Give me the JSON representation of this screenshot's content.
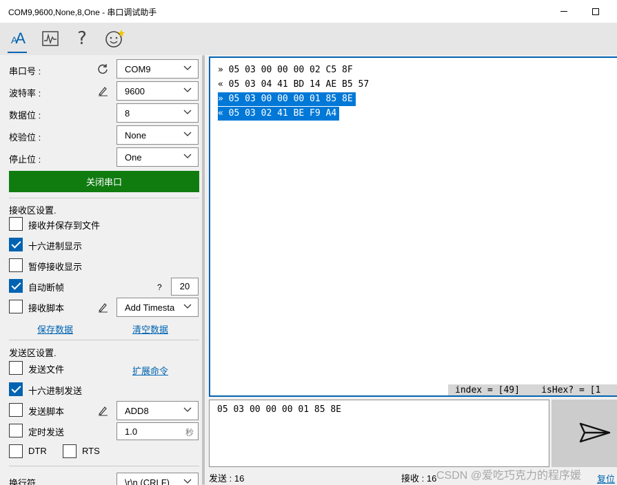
{
  "window": {
    "title": "COM9,9600,None,8,One - 串口调试助手"
  },
  "toolbar": {
    "font_glyph": "AA",
    "help_glyph": "?"
  },
  "serial": {
    "port_label": "串口号 :",
    "port_value": "COM9",
    "baud_label": "波特率 :",
    "baud_value": "9600",
    "databits_label": "数据位 :",
    "databits_value": "8",
    "parity_label": "校验位 :",
    "parity_value": "None",
    "stopbits_label": "停止位 :",
    "stopbits_value": "One",
    "toggle_label": "关闭串口"
  },
  "receive": {
    "section_title": "接收区设置.",
    "save_to_file": {
      "label": "接收并保存到文件",
      "checked": false
    },
    "hex_display": {
      "label": "十六进制显示",
      "checked": true
    },
    "pause_display": {
      "label": "暂停接收显示",
      "checked": false
    },
    "auto_frame": {
      "label": "自动断帧",
      "checked": true
    },
    "frame_question": "?",
    "frame_timeout": "20",
    "script": {
      "label": "接收脚本",
      "checked": false
    },
    "script_value": "Add Timesta",
    "save_link": "保存数据",
    "clear_link": "清空数据"
  },
  "send": {
    "section_title": "发送区设置.",
    "send_file": {
      "label": "发送文件",
      "checked": false
    },
    "expand_link": "扩展命令",
    "hex_send": {
      "label": "十六进制发送",
      "checked": true
    },
    "script": {
      "label": "发送脚本",
      "checked": false
    },
    "script_value": "ADD8",
    "timed": {
      "label": "定时发送",
      "checked": false
    },
    "timed_value": "1.0",
    "timed_unit": "秒",
    "dtr": {
      "label": "DTR",
      "checked": false
    },
    "rts": {
      "label": "RTS",
      "checked": false
    },
    "newline_label": "换行符",
    "newline_value": "\\r\\n (CRLF)"
  },
  "receive_area": {
    "lines": [
      {
        "text": "» 05 03 00 00 00 02 C5 8F",
        "selected": false
      },
      {
        "text": "« 05 03 04 41 BD 14 AE B5 57",
        "selected": false
      },
      {
        "text": "» 05 03 00 00 00 01 85 8E",
        "selected": true
      },
      {
        "text": "« 05 03 02 41 BE F9 A4",
        "selected": true
      }
    ],
    "status": "index = [49]    isHex? = [1"
  },
  "send_area": {
    "text": "05 03 00 00 00 01 85 8E"
  },
  "footer": {
    "sent": "发送 : 16",
    "received": "接收 : 16",
    "reset_link": "复位",
    "watermark": "CSDN @爱吃巧克力的程序媛"
  },
  "colors": {
    "accent": "#0063b1",
    "open_button": "#107c10",
    "selection": "#0078d7"
  }
}
